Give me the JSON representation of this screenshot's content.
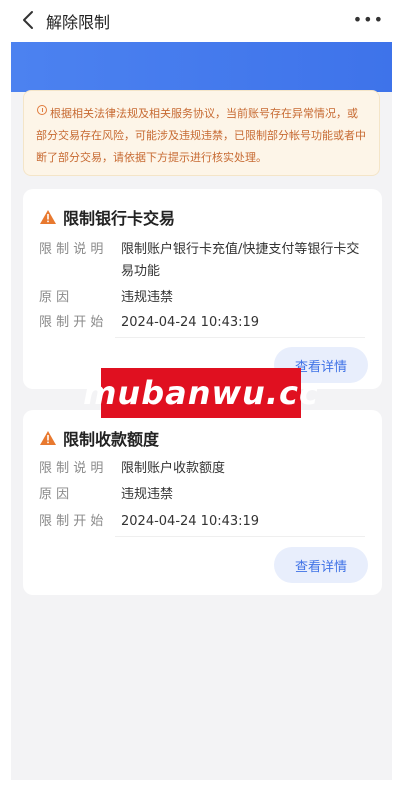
{
  "header": {
    "title": "解除限制",
    "more": "•••"
  },
  "notice": {
    "text": "根据相关法律法规及相关服务协议，当前账号存在异常情况，或部分交易存在风险，可能涉及违规违禁，已限制部分帐号功能或者中断了部分交易，请依据下方提示进行核实处理。"
  },
  "restrictions": [
    {
      "title": "限制银行卡交易",
      "rows": [
        {
          "key": "限 制 说 明",
          "value": "限制账户银行卡充值/快捷支付等银行卡交易功能"
        },
        {
          "key": "原        因",
          "value": "违规违禁"
        },
        {
          "key": "限 制 开 始",
          "value": "2024-04-24 10:43:19"
        }
      ],
      "button": "查看详情"
    },
    {
      "title": "限制收款额度",
      "rows": [
        {
          "key": "限 制 说 明",
          "value": "限制账户收款额度"
        },
        {
          "key": "原        因",
          "value": "违规违禁"
        },
        {
          "key": "限 制 开 始",
          "value": "2024-04-24 10:43:19"
        }
      ],
      "button": "查看详情"
    }
  ],
  "watermark": "mubanwu.cc",
  "colors": {
    "accent": "#3f72e6",
    "warning": "#e8792f",
    "notice_bg": "#fdf5e8",
    "watermark_bg": "#e01020"
  },
  "icons": {
    "back": "chevron-left-icon",
    "more": "more-dots-icon",
    "warning": "warning-triangle-icon",
    "info": "info-circle-icon"
  }
}
